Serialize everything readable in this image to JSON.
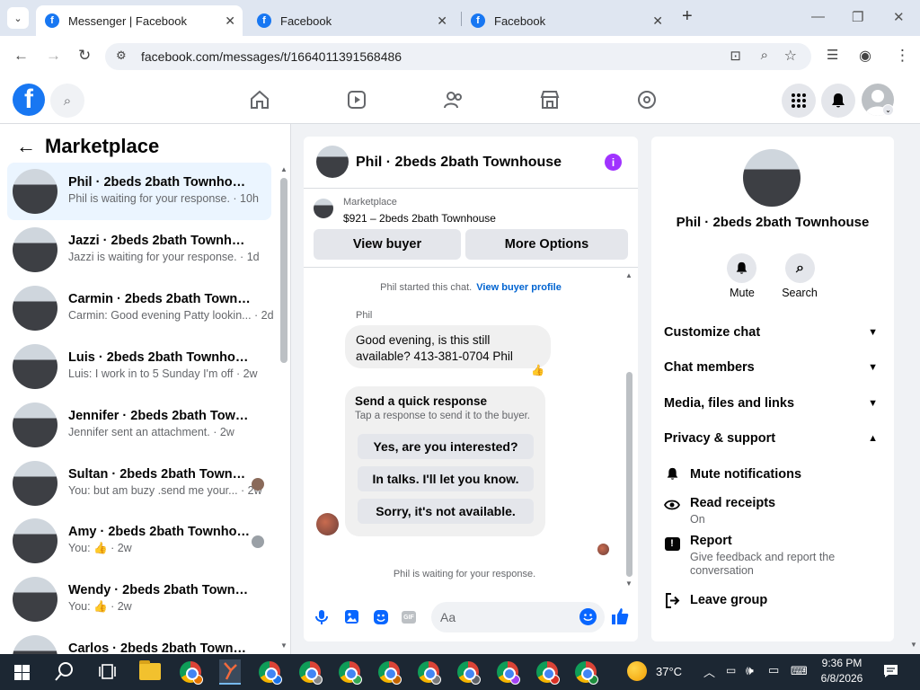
{
  "browser": {
    "tabs": [
      {
        "title": "Messenger | Facebook",
        "active": true
      },
      {
        "title": "Facebook",
        "active": false
      },
      {
        "title": "Facebook",
        "active": false
      }
    ],
    "url": "facebook.com/messages/t/1664011391568486"
  },
  "sidebar": {
    "title": "Marketplace",
    "threads": [
      {
        "name": "Phil · 2beds 2bath Townhouse",
        "snippet": "Phil is waiting for your response. · 10h",
        "selected": true
      },
      {
        "name": "Jazzi · 2beds 2bath Townhouse",
        "snippet": "Jazzi is waiting for your response. · 1d"
      },
      {
        "name": "Carmin · 2beds 2bath Townhouse",
        "snippet": "Carmin: Good evening Patty lookin... · 2d"
      },
      {
        "name": "Luis · 2beds 2bath Townhouse",
        "snippet": "Luis: I work in to 5 Sunday I'm off · 2w"
      },
      {
        "name": "Jennifer · 2beds 2bath Townhouse",
        "snippet": "Jennifer sent an attachment. · 2w"
      },
      {
        "name": "Sultan · 2beds 2bath Townho...",
        "snippet": "You: but am buzy .send me your... · 2w"
      },
      {
        "name": "Amy · 2beds 2bath Townhouse",
        "snippet": "You: 👍 · 2w"
      },
      {
        "name": "Wendy · 2beds 2bath Townhouse",
        "snippet": "You: 👍 · 2w"
      },
      {
        "name": "Carlos · 2beds 2bath Townhouse",
        "snippet": ""
      }
    ]
  },
  "chat": {
    "title": "Phil · 2beds 2bath Townhouse",
    "listing_source": "Marketplace",
    "listing": "$921 – 2beds 2bath Townhouse",
    "view_buyer": "View buyer",
    "more_options": "More Options",
    "started_text": "Phil started this chat.",
    "view_profile": "View buyer profile",
    "sender": "Phil",
    "message": "Good evening, is this still available? 413-381-0704 Phil",
    "reaction": "👍",
    "quick_title": "Send a quick response",
    "quick_sub": "Tap a response to send it to the buyer.",
    "quick_replies": [
      "Yes, are you interested?",
      "In talks. I'll let you know.",
      "Sorry, it's not available."
    ],
    "waiting": "Phil is waiting for your response.",
    "composer_placeholder": "Aa"
  },
  "info": {
    "name": "Phil · 2beds 2bath Townhouse",
    "mute": "Mute",
    "search": "Search",
    "sections": [
      "Customize chat",
      "Chat members",
      "Media, files and links",
      "Privacy & support"
    ],
    "mute_notifications": "Mute notifications",
    "read_receipts": "Read receipts",
    "read_receipts_state": "On",
    "report": "Report",
    "report_sub": "Give feedback and report the conversation",
    "leave": "Leave group"
  },
  "taskbar": {
    "weather": "37°C",
    "time": "9:36 PM",
    "date": "6/8/2026"
  },
  "colors": {
    "facebook_blue": "#1877f2",
    "messenger_purple": "#a033ff",
    "link": "#0064d1"
  }
}
